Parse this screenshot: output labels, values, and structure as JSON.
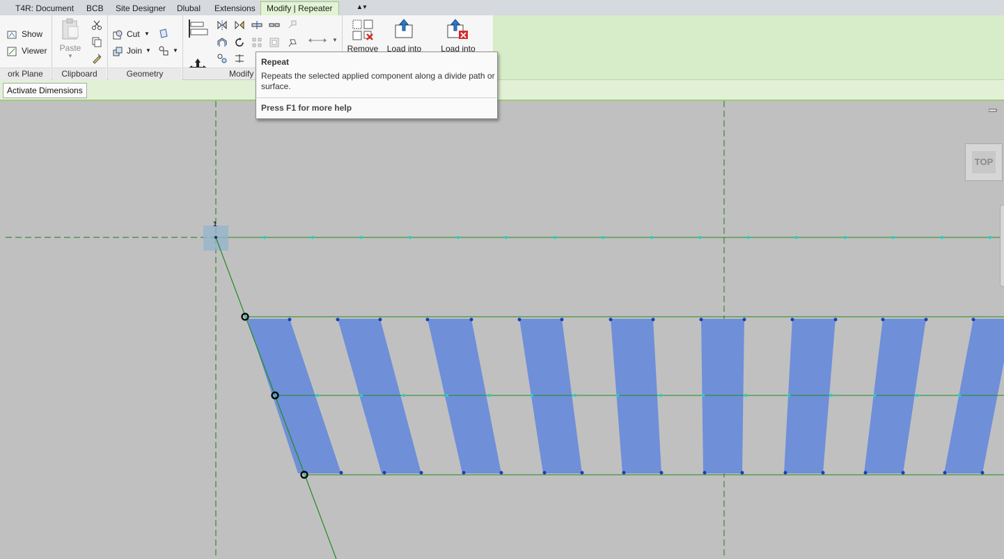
{
  "tabs": [
    "T4R: Document",
    "BCB",
    "Site Designer",
    "Dlubal",
    "Extensions",
    "Modify | Repeater"
  ],
  "qat_toggle": "▲▾",
  "ribbon": {
    "panels": {
      "work_plane": "ork Plane",
      "clipboard": "Clipboard",
      "geometry": "Geometry",
      "modify": "Modify"
    },
    "work_plane": {
      "show": "Show",
      "viewer": "Viewer"
    },
    "clipboard": {
      "paste": "Paste"
    },
    "geometry": {
      "cut": "Cut",
      "join": "Join"
    },
    "component": {
      "remove": "Remove",
      "load_into_1": "Load into",
      "load_into_2": "Load into"
    }
  },
  "options_bar": {
    "activate_dimensions": "Activate Dimensions"
  },
  "tooltip": {
    "title": "Repeat",
    "description": "Repeats the selected applied component along a divide path or surface.",
    "help": "Press F1 for more help"
  },
  "view_cube": {
    "face": "TOP"
  },
  "canvas": {
    "level_marker": "1",
    "colors": {
      "background": "#c0c0c0",
      "panel_fill": "#6f8fd8",
      "path_line": "#1f8a1f",
      "node_dot": "#26d0c8",
      "ref_dash": "#1c7a1c"
    },
    "repeater_panels": 9
  },
  "colors": {
    "ribbon_context": "#d7ecc8",
    "active_tab": "#e3f3d5",
    "option_bar": "#e2f1d6"
  }
}
